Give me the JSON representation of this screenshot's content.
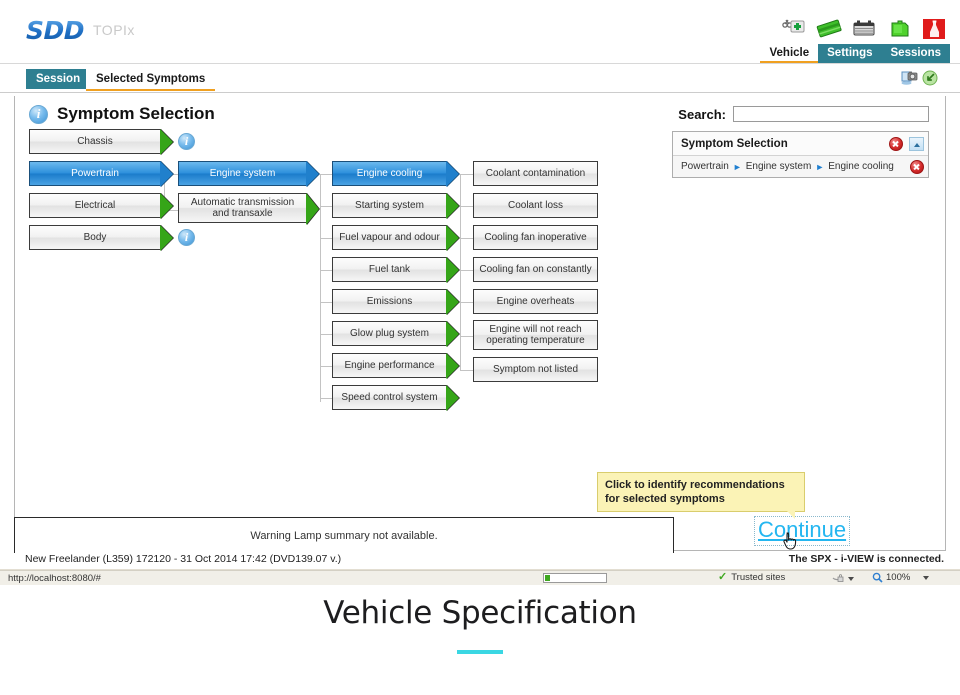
{
  "app": {
    "logo": "SDD",
    "product": "TOPIx",
    "toolbar_icons": [
      {
        "name": "diagnostics-kit-icon"
      },
      {
        "name": "green-card-icon"
      },
      {
        "name": "battery-icon"
      },
      {
        "name": "fuel-can-icon"
      },
      {
        "name": "fluid-bottle-icon"
      }
    ],
    "top_nav": [
      {
        "label": "Vehicle",
        "active": true
      },
      {
        "label": "Settings",
        "active": false
      },
      {
        "label": "Sessions",
        "active": false
      }
    ],
    "tabs": [
      {
        "label": "Session",
        "active": true
      },
      {
        "label": "Selected Symptoms",
        "active": false
      }
    ],
    "tabbar_icons": [
      {
        "name": "screenshot-camera-icon"
      },
      {
        "name": "refresh-icon"
      }
    ]
  },
  "page": {
    "title": "Symptom Selection"
  },
  "search": {
    "label": "Search:",
    "value": "",
    "placeholder": ""
  },
  "selection_panel": {
    "title": "Symptom Selection",
    "breadcrumb": [
      "Powertrain",
      "Engine system",
      "Engine cooling"
    ],
    "breadcrumb_separator": "►"
  },
  "tree": {
    "columns": [
      {
        "name": "system-column",
        "nodes": [
          {
            "label": "Chassis",
            "selected": false,
            "info": true
          },
          {
            "label": "Powertrain",
            "selected": true,
            "info": false
          },
          {
            "label": "Electrical",
            "selected": false,
            "info": false
          },
          {
            "label": "Body",
            "selected": false,
            "info": true
          }
        ]
      },
      {
        "name": "subsystem-column",
        "nodes": [
          {
            "label": "Engine system",
            "selected": true,
            "info": false
          },
          {
            "label": "Automatic transmission and transaxle",
            "selected": false,
            "info": false
          }
        ]
      },
      {
        "name": "component-column",
        "nodes": [
          {
            "label": "Engine cooling",
            "selected": true,
            "info": false
          },
          {
            "label": "Starting system",
            "selected": false,
            "info": false
          },
          {
            "label": "Fuel vapour and odour",
            "selected": false,
            "info": false
          },
          {
            "label": "Fuel tank",
            "selected": false,
            "info": false
          },
          {
            "label": "Emissions",
            "selected": false,
            "info": false
          },
          {
            "label": "Glow plug system",
            "selected": false,
            "info": false
          },
          {
            "label": "Engine performance",
            "selected": false,
            "info": false
          },
          {
            "label": "Speed control system",
            "selected": false,
            "info": false
          }
        ]
      },
      {
        "name": "symptom-column",
        "nodes": [
          {
            "label": "Coolant contamination",
            "selected": false,
            "info": false
          },
          {
            "label": "Coolant loss",
            "selected": false,
            "info": false
          },
          {
            "label": "Cooling fan inoperative",
            "selected": false,
            "info": false
          },
          {
            "label": "Cooling fan on constantly",
            "selected": false,
            "info": false
          },
          {
            "label": "Engine overheats",
            "selected": false,
            "info": false
          },
          {
            "label": "Engine will not reach operating temperature",
            "selected": false,
            "info": false
          },
          {
            "label": "Symptom not listed",
            "selected": false,
            "info": false
          }
        ]
      }
    ]
  },
  "tooltip": {
    "text": "Click to identify recommendations for selected symptoms"
  },
  "footer": {
    "warning_lamp": "Warning Lamp summary not available.",
    "continue_label": "Continue",
    "vehicle_info": "New Freelander (L359) 172120 - 31 Oct 2014 17:42 (DVD139.07 v.)",
    "connection_status": "The SPX - i-VIEW is connected."
  },
  "statusbar": {
    "url": "http://localhost:8080/#",
    "trusted_label": "Trusted sites",
    "zoom_level": "100%"
  },
  "caption": {
    "title": "Vehicle Specification"
  },
  "colors": {
    "selected_node": "#2e90dc",
    "node_arrow": "#35a518",
    "tab_active": "#2e7f91",
    "tab_underline": "#f0a020",
    "continue_link": "#24b6f0",
    "tooltip_bg": "#fbf3b6",
    "close_button": "#d42a2a",
    "caption_rule": "#3ad7e3"
  }
}
